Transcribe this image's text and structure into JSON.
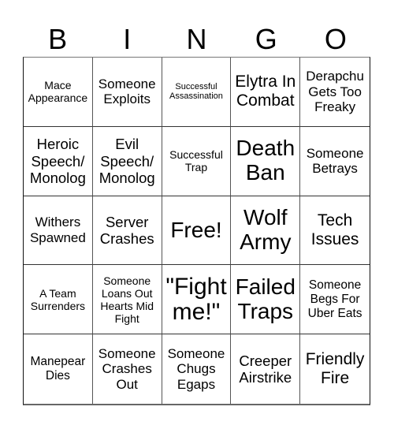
{
  "header": {
    "letters": [
      "B",
      "I",
      "N",
      "G",
      "O"
    ]
  },
  "grid": {
    "rows": [
      [
        "Mace Appearance",
        "Someone Exploits",
        "Successful Assassination",
        "Elytra In Combat",
        "Derapchu Gets Too Freaky"
      ],
      [
        "Heroic Speech/ Monolog",
        "Evil Speech/ Monolog",
        "Successful Trap",
        "Death Ban",
        "Someone Betrays"
      ],
      [
        "Withers Spawned",
        "Server Crashes",
        "Free!",
        "Wolf Army",
        "Tech Issues"
      ],
      [
        "A Team Surrenders",
        "Someone Loans Out Hearts Mid Fight",
        "\"Fight me!\"",
        "Failed Traps",
        "Someone Begs For Uber Eats"
      ],
      [
        "Manepear Dies",
        "Someone Crashes Out",
        "Someone Chugs Egaps",
        "Creeper Airstrike",
        "Friendly Fire"
      ]
    ]
  }
}
